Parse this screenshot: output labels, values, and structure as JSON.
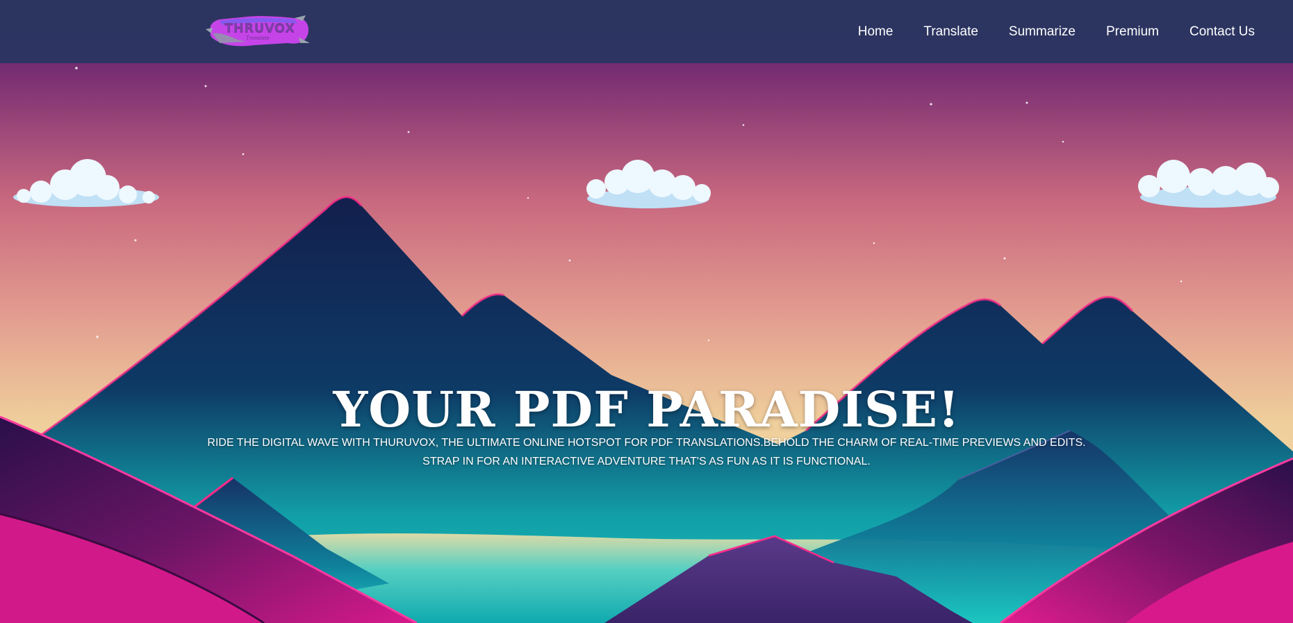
{
  "colors": {
    "navbar_bg": "#2c355f",
    "sky_top": "#5b2a6b",
    "sky_mid": "#d9858f",
    "sky_low": "#ecd09a",
    "mountain_dark": "#0f2450",
    "mountain_edge": "#ff1e88",
    "valley_teal": "#12b5b5",
    "hill_magenta": "#d41a8a",
    "text": "#ffffff"
  },
  "logo": {
    "text": "THRUVOX",
    "subtext": "Translate",
    "icon": "paint-stroke-logo"
  },
  "nav": {
    "items": [
      {
        "label": "Home"
      },
      {
        "label": "Translate"
      },
      {
        "label": "Summarize"
      },
      {
        "label": "Premium"
      },
      {
        "label": "Contact Us"
      }
    ]
  },
  "hero": {
    "title": "YOUR PDF PARADISE!",
    "subtitle_line1": "RIDE THE DIGITAL WAVE WITH THURUVOX, THE ULTIMATE ONLINE HOTSPOT FOR PDF TRANSLATIONS.BEHOLD THE CHARM OF REAL-TIME PREVIEWS AND EDITS.",
    "subtitle_line2": "STRAP IN FOR AN INTERACTIVE ADVENTURE THAT'S AS FUN AS IT IS FUNCTIONAL.",
    "background": "mountain-sunset-illustration",
    "decor_icons": [
      "cloud-icon",
      "cloud-icon",
      "cloud-icon",
      "star-icon"
    ]
  }
}
